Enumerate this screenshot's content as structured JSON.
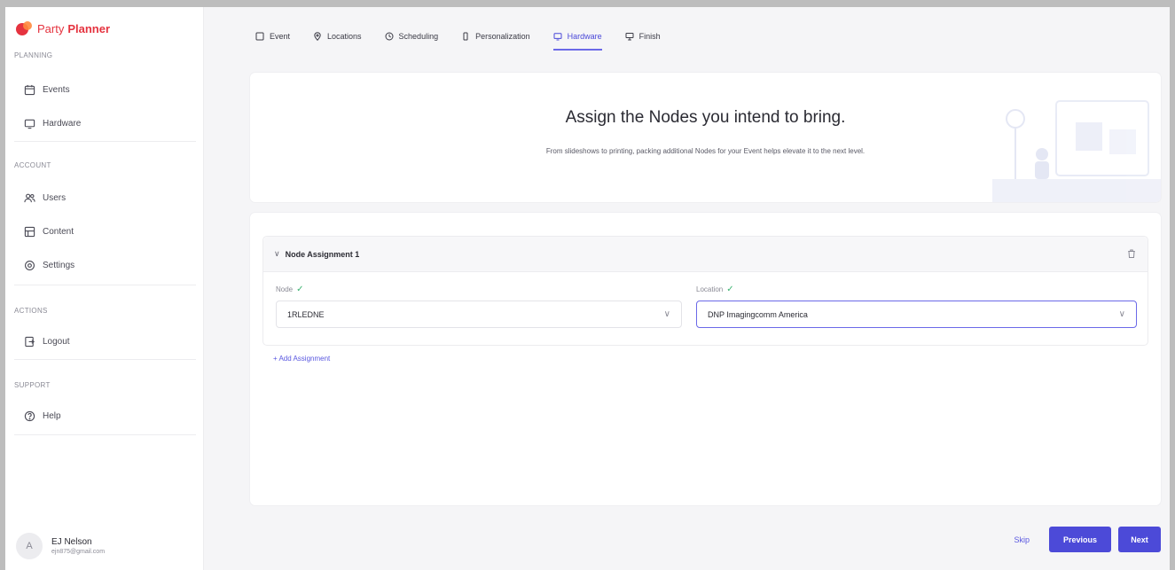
{
  "brand": {
    "party": "Party",
    "planner": "Planner"
  },
  "sidebar": {
    "sections": [
      {
        "label": "PLANNING",
        "items": [
          {
            "label": "Events",
            "icon": "calendar-icon"
          },
          {
            "label": "Hardware",
            "icon": "monitor-icon"
          }
        ]
      },
      {
        "label": "ACCOUNT",
        "items": [
          {
            "label": "Users",
            "icon": "users-icon"
          },
          {
            "label": "Content",
            "icon": "content-icon"
          },
          {
            "label": "Settings",
            "icon": "gear-icon"
          }
        ]
      },
      {
        "label": "ACTIONS",
        "items": [
          {
            "label": "Logout",
            "icon": "logout-icon"
          }
        ]
      },
      {
        "label": "SUPPORT",
        "items": [
          {
            "label": "Help",
            "icon": "help-icon"
          }
        ]
      }
    ]
  },
  "user": {
    "initial": "A",
    "name": "EJ Nelson",
    "email": "ejn875@gmail.com"
  },
  "tabs": [
    {
      "label": "Event",
      "icon": "square-icon",
      "active": false
    },
    {
      "label": "Locations",
      "icon": "pin-icon",
      "active": false
    },
    {
      "label": "Scheduling",
      "icon": "clock-icon",
      "active": false
    },
    {
      "label": "Personalization",
      "icon": "phone-icon",
      "active": false
    },
    {
      "label": "Hardware",
      "icon": "monitor-icon",
      "active": true
    },
    {
      "label": "Finish",
      "icon": "flag-icon",
      "active": false
    }
  ],
  "hero": {
    "title": "Assign the Nodes you intend to bring.",
    "subtitle": "From slideshows to printing, packing additional Nodes for your Event helps elevate it to the next level."
  },
  "assignment": {
    "title": "Node Assignment 1",
    "node_label": "Node",
    "node_value": "1RLEDNE",
    "location_label": "Location",
    "location_value": "DNP Imagingcomm America",
    "add_label": "+ Add Assignment"
  },
  "actions": {
    "skip": "Skip",
    "previous": "Previous",
    "next": "Next"
  },
  "colors": {
    "accent": "#4c4ad8",
    "brand": "#e5333f",
    "check": "#3cb371"
  }
}
